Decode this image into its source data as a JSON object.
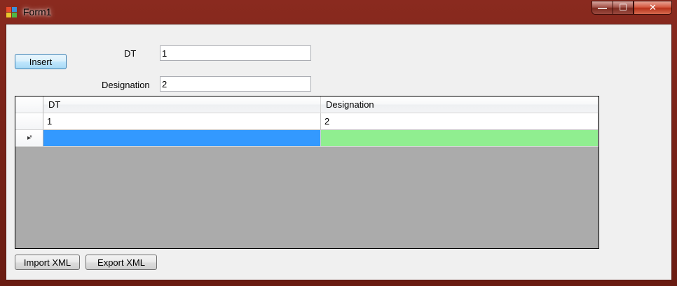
{
  "window": {
    "title": "Form1",
    "caption_buttons": {
      "minimize_glyph": "—",
      "maximize_glyph": "☐",
      "close_glyph": "✕"
    }
  },
  "form": {
    "insert_label": "Insert",
    "dt_label": "DT",
    "dt_value": "1",
    "designation_label": "Designation",
    "designation_value": "2",
    "import_label": "Import XML",
    "export_label": "Export XML"
  },
  "grid": {
    "columns": [
      "DT",
      "Designation"
    ],
    "rows": [
      [
        "1",
        "2"
      ]
    ],
    "new_row_indicator": "▸*",
    "colors": {
      "selected_cell_1": "#3399ff",
      "selected_cell_2": "#90ee90",
      "background": "#ababab"
    }
  },
  "colors": {
    "titlebar_accent": "#7a2318",
    "client_background": "#f0f0f0"
  }
}
